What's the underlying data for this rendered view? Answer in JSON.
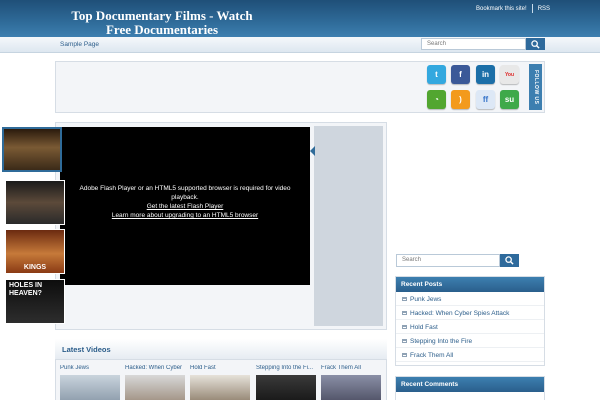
{
  "header": {
    "title": "Top Documentary Films - Watch Free Documentaries",
    "links": [
      "Bookmark this site!",
      "RSS"
    ]
  },
  "nav": {
    "items": [
      "Sample Page"
    ],
    "search_placeholder": "Search"
  },
  "social": {
    "icons": [
      "twitter-icon",
      "facebook-icon",
      "linkedin-icon",
      "youtube-icon",
      "feedburner-icon",
      "rss-icon",
      "friendfeed-icon",
      "stumbleupon-icon"
    ],
    "follow_label": "FOLLOW US",
    "colors": {
      "twitter": "#33a8df",
      "facebook": "#3b5998",
      "linkedin": "#1c6fa8",
      "youtube": "#e8e8e8",
      "feedburner": "#52a630",
      "rss": "#f39a1c",
      "friendfeed": "#dde8f6",
      "stumbleupon": "#3fa94a"
    }
  },
  "featured": {
    "player_message": "Adobe Flash Player or an HTML5 supported browser is required for video playback.",
    "flash_link": "Get the latest Flash Player",
    "html5_link": "Learn more about upgrading to an HTML5 browser",
    "thumbs": [
      "video-thumb-1",
      "video-thumb-2",
      "video-thumb-3",
      "video-thumb-4"
    ],
    "thumb_captions": [
      "KINGS",
      "HOLES IN HEAVEN?"
    ]
  },
  "latest_videos": {
    "title": "Latest Videos",
    "items": [
      "Punk Jews",
      "Hacked: When Cyber",
      "Hold Fast",
      "Stepping Into the Fi...",
      "Frack Them All"
    ]
  },
  "sidebar": {
    "search_placeholder": "Search",
    "recent_posts_title": "Recent Posts",
    "recent_posts": [
      "Punk Jews",
      "Hacked: When Cyber Spies Attack",
      "Hold Fast",
      "Stepping Into the Fire",
      "Frack Them All"
    ],
    "recent_comments_title": "Recent Comments"
  },
  "colors": {
    "header_blue": "#2f6b99",
    "link_blue": "#2b5d8a"
  }
}
